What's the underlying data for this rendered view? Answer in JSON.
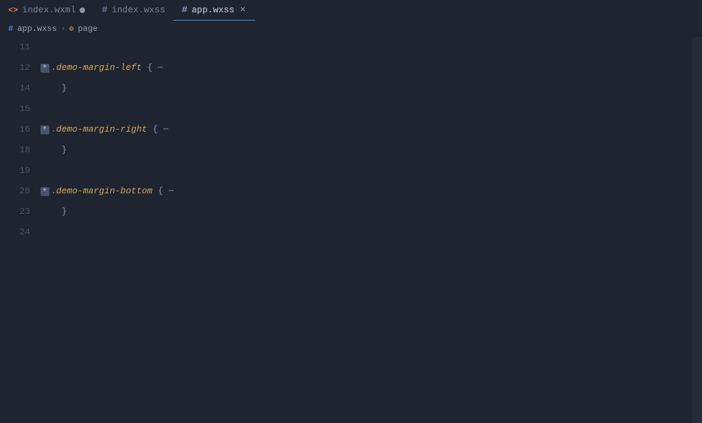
{
  "tabs": [
    {
      "label": "index.wxml",
      "iconType": "code",
      "dirty": true,
      "active": false,
      "closable": false
    },
    {
      "label": "index.wxss",
      "iconType": "hash",
      "dirty": false,
      "active": false,
      "closable": false
    },
    {
      "label": "app.wxss",
      "iconType": "hash",
      "dirty": false,
      "active": true,
      "closable": true
    }
  ],
  "breadcrumb": {
    "file": "app.wxss",
    "symbol": "page"
  },
  "lines": [
    {
      "num": "11",
      "fold": false,
      "tokens": []
    },
    {
      "num": "12",
      "fold": true,
      "tokens": [
        {
          "t": ".",
          "c": "tok-punct"
        },
        {
          "t": "demo-margin-left",
          "c": "tok-selector"
        },
        {
          "t": " {",
          "c": "tok-punct"
        },
        {
          "t": " ⋯",
          "c": "tok-fold-dots"
        }
      ]
    },
    {
      "num": "14",
      "fold": false,
      "tokens": [
        {
          "t": "  }",
          "c": "tok-punct"
        }
      ]
    },
    {
      "num": "15",
      "fold": false,
      "tokens": []
    },
    {
      "num": "16",
      "fold": true,
      "tokens": [
        {
          "t": ".",
          "c": "tok-punct"
        },
        {
          "t": "demo-margin-right",
          "c": "tok-selector"
        },
        {
          "t": " {",
          "c": "tok-punct"
        },
        {
          "t": " ⋯",
          "c": "tok-fold-dots"
        }
      ]
    },
    {
      "num": "18",
      "fold": false,
      "tokens": [
        {
          "t": "  }",
          "c": "tok-punct"
        }
      ]
    },
    {
      "num": "19",
      "fold": false,
      "tokens": []
    },
    {
      "num": "20",
      "fold": true,
      "tokens": [
        {
          "t": ".",
          "c": "tok-punct"
        },
        {
          "t": "demo-margin-bottom",
          "c": "tok-selector"
        },
        {
          "t": " {",
          "c": "tok-punct"
        },
        {
          "t": " ⋯",
          "c": "tok-fold-dots"
        }
      ]
    },
    {
      "num": "23",
      "fold": false,
      "tokens": [
        {
          "t": "  }",
          "c": "tok-punct"
        }
      ]
    },
    {
      "num": "24",
      "fold": false,
      "tokens": []
    }
  ],
  "icons": {
    "expand": "+",
    "close": "×",
    "dirty": "●",
    "chevron": "›"
  }
}
